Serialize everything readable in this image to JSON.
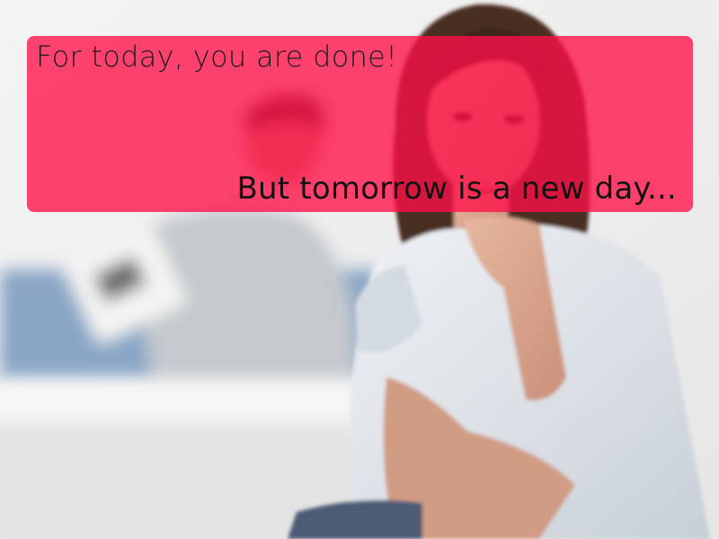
{
  "banner": {
    "line1": "For today, you are done!",
    "line2": "But tomorrow is a new day..."
  },
  "colors": {
    "banner_overlay": "#ff1048",
    "text": "#151515"
  }
}
